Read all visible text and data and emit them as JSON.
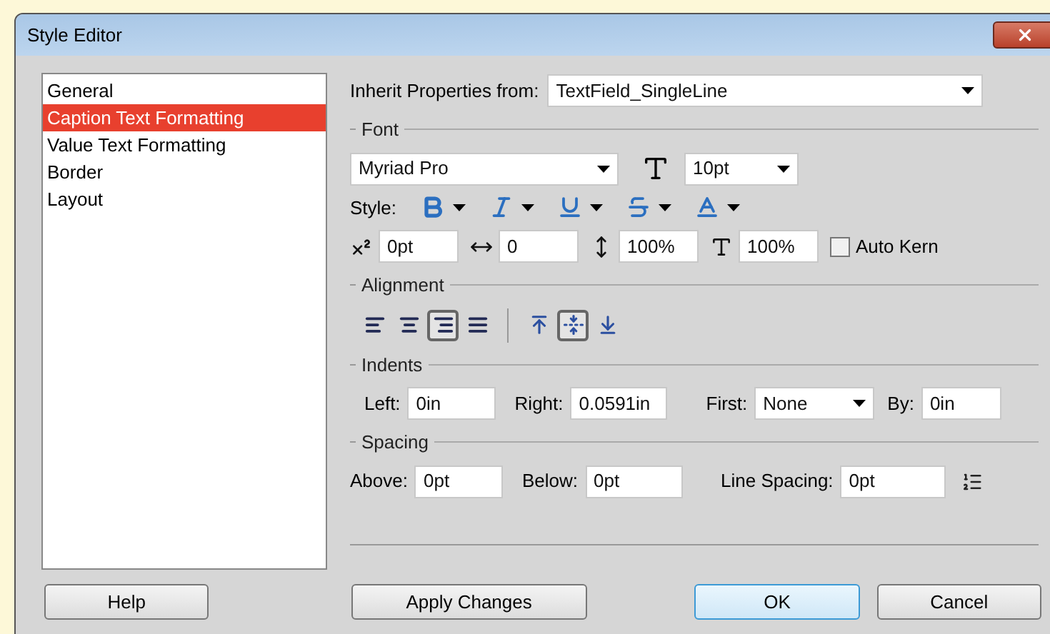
{
  "window": {
    "title": "Style Editor"
  },
  "sidebar": {
    "items": [
      {
        "label": "General",
        "selected": false
      },
      {
        "label": "Caption Text Formatting",
        "selected": true
      },
      {
        "label": "Value Text Formatting",
        "selected": false
      },
      {
        "label": "Border",
        "selected": false
      },
      {
        "label": "Layout",
        "selected": false
      }
    ]
  },
  "inherit": {
    "label": "Inherit Properties from:",
    "value": "TextField_SingleLine"
  },
  "font": {
    "heading": "Font",
    "family": "Myriad Pro",
    "size": "10pt",
    "style_label": "Style:",
    "style_buttons": [
      {
        "kind": "bold"
      },
      {
        "kind": "italic"
      },
      {
        "kind": "underline"
      },
      {
        "kind": "strike"
      },
      {
        "kind": "color"
      }
    ],
    "metrics": [
      {
        "kind": "baseline",
        "value": "0pt"
      },
      {
        "kind": "kerning",
        "value": "0"
      },
      {
        "kind": "vscale",
        "value": "100%"
      },
      {
        "kind": "hscale",
        "value": "100%"
      }
    ],
    "auto_kern": {
      "label": "Auto Kern",
      "checked": false
    }
  },
  "alignment": {
    "heading": "Alignment",
    "horizontal": [
      {
        "kind": "left",
        "selected": false
      },
      {
        "kind": "center",
        "selected": false
      },
      {
        "kind": "right",
        "selected": true
      },
      {
        "kind": "justify",
        "selected": false
      }
    ],
    "vertical": [
      {
        "kind": "top",
        "selected": false
      },
      {
        "kind": "middle",
        "selected": true
      },
      {
        "kind": "bottom",
        "selected": false
      }
    ]
  },
  "indents": {
    "heading": "Indents",
    "left_label": "Left:",
    "left": "0in",
    "right_label": "Right:",
    "right": "0.0591in",
    "first_label": "First:",
    "first": "None",
    "by_label": "By:",
    "by": "0in"
  },
  "spacing": {
    "heading": "Spacing",
    "above_label": "Above:",
    "above": "0pt",
    "below_label": "Below:",
    "below": "0pt",
    "line_label": "Line Spacing:",
    "line": "0pt"
  },
  "buttons": {
    "help": "Help",
    "apply": "Apply Changes",
    "ok": "OK",
    "cancel": "Cancel"
  }
}
